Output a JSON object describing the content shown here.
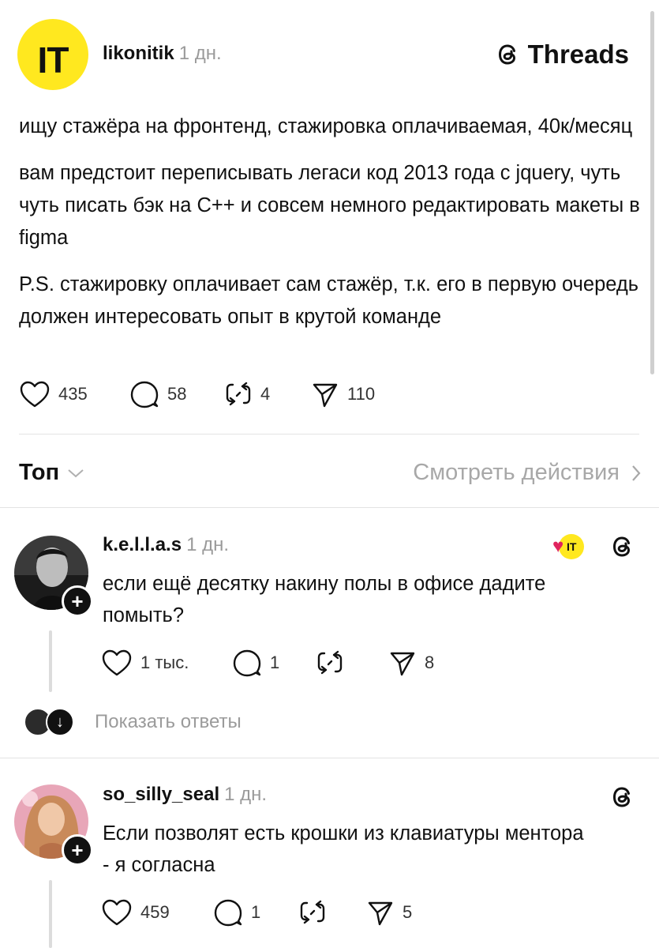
{
  "post": {
    "avatar_text": "IT",
    "author": "likonitik",
    "time": "1 дн.",
    "brand": "Threads",
    "paragraphs": [
      "ищу стажёра на фронтенд, стажировка оплачиваемая, 40к/месяц",
      "вам предстоит переписывать легаси код 2013 года с jquery, чуть чуть писать бэк на C++ и совсем немного редактировать макеты в figma",
      "P.S. стажировку оплачивает сам стажёр, т.к. его в первую очередь должен интересовать опыт в крутой команде"
    ],
    "likes": "435",
    "comments": "58",
    "reposts": "4",
    "shares": "110"
  },
  "sort": {
    "label": "Топ",
    "view_activity": "Смотреть действия"
  },
  "comments": [
    {
      "author": "k.e.l.l.a.s",
      "time": "1 дн.",
      "text": "если ещё десятку накину полы в офисе дадите помыть?",
      "likes": "1 тыс.",
      "comments": "1",
      "reposts": "",
      "shares": "8",
      "liked_by_author_badge": "IT",
      "show_replies": "Показать ответы"
    },
    {
      "author": "so_silly_seal",
      "time": "1 дн.",
      "text": "Если позволят есть крошки из клавиатуры ментора - я согласна",
      "likes": "459",
      "comments": "1",
      "reposts": "",
      "shares": "5"
    }
  ],
  "colors": {
    "brand_yellow": "#FFE81F",
    "muted_text": "#9a9a9a",
    "like_red": "#e0245e"
  }
}
